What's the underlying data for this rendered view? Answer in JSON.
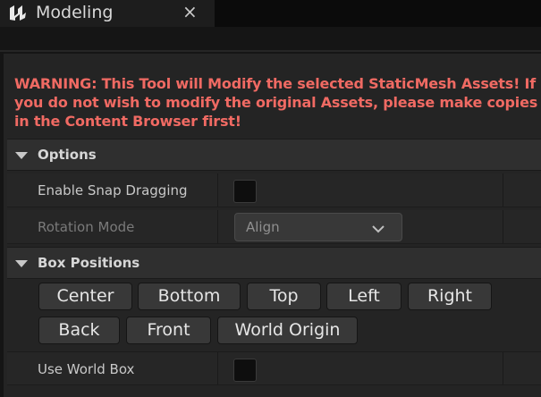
{
  "tab": {
    "title": "Modeling",
    "close_glyph": "×",
    "icon": "unreal-logo-icon"
  },
  "warning_text": "WARNING: This Tool will Modify the selected StaticMesh Assets! If you do not wish to modify the original Assets, please make copies in the Content Browser first!",
  "options": {
    "title": "Options",
    "enable_snap_label": "Enable Snap Dragging",
    "enable_snap_checked": false,
    "rotation_label": "Rotation Mode",
    "rotation_value": "Align"
  },
  "box_positions": {
    "title": "Box Positions",
    "buttons": [
      "Center",
      "Bottom",
      "Top",
      "Left",
      "Right",
      "Back",
      "Front",
      "World Origin"
    ],
    "use_world_box_label": "Use World Box",
    "use_world_box_checked": false
  },
  "colors": {
    "warning": "#f06a63",
    "panel": "#242424",
    "header": "#2f2f2f"
  }
}
